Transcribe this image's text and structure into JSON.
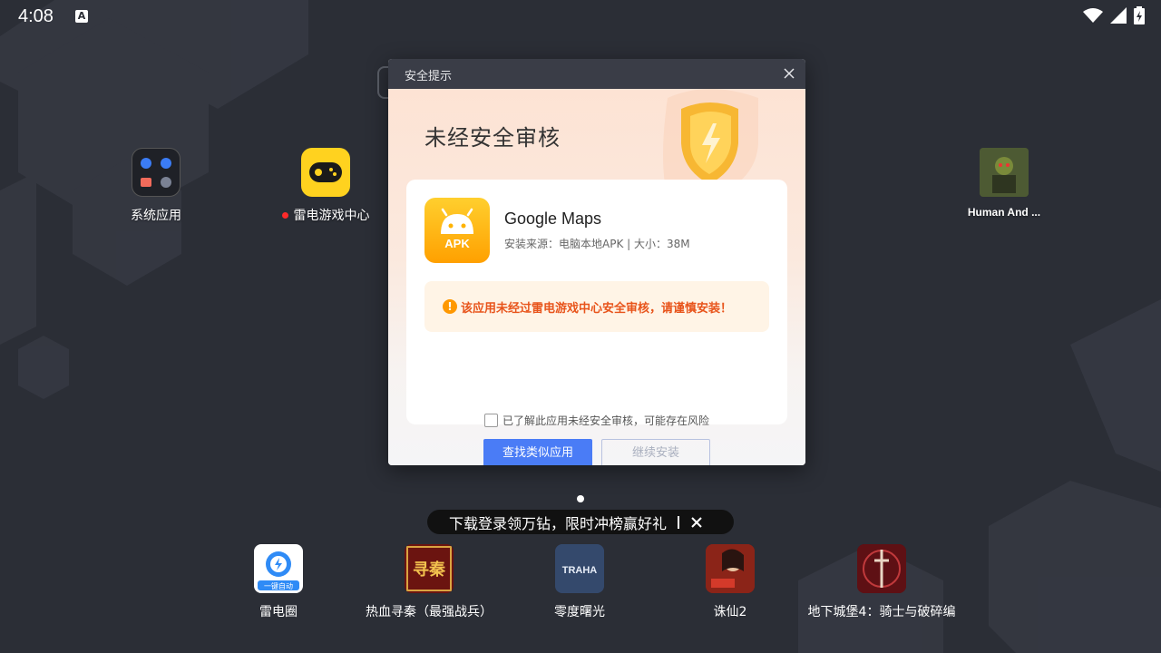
{
  "status_bar": {
    "time": "4:08",
    "notification_icon": "A",
    "icons": [
      "wifi-icon",
      "cell-signal-icon",
      "battery-charging-icon"
    ]
  },
  "desktop": {
    "apps": [
      {
        "label": "系统应用",
        "icon": "system-apps-folder-icon"
      },
      {
        "label": "雷电游戏中心",
        "icon": "gamepad-icon",
        "badge": "new"
      },
      {
        "label": "Human And ...",
        "icon": "game-thumbnail-icon"
      }
    ]
  },
  "dialog": {
    "title": "安全提示",
    "heading": "未经安全审核",
    "app": {
      "name": "Google Maps",
      "icon_text": "APK",
      "meta": "安装来源：电脑本地APK | 大小：38M"
    },
    "warning": "该应用未经过雷电游戏中心安全审核，请谨慎安装！",
    "checkbox_label": "已了解此应用未经安全审核，可能存在风险",
    "primary_button": "查找类似应用",
    "secondary_button": "继续安装"
  },
  "promo": {
    "text": "下载登录领万钻，限时冲榜赢好礼"
  },
  "dock": {
    "apps": [
      {
        "label": "雷电圈",
        "icon_text": "一键自动"
      },
      {
        "label": "热血寻秦（最强战兵）",
        "icon_text": "寻秦"
      },
      {
        "label": "零度曙光",
        "icon_text": "TRAHA"
      },
      {
        "label": "诛仙2",
        "icon_text": ""
      },
      {
        "label": "地下城堡4：骑士与破碎编",
        "icon_text": ""
      }
    ]
  },
  "colors": {
    "background": "#2b2e36",
    "primary_button": "#4a7cf6",
    "warning_text": "#e8541b",
    "apk_icon": "#ffb300"
  }
}
